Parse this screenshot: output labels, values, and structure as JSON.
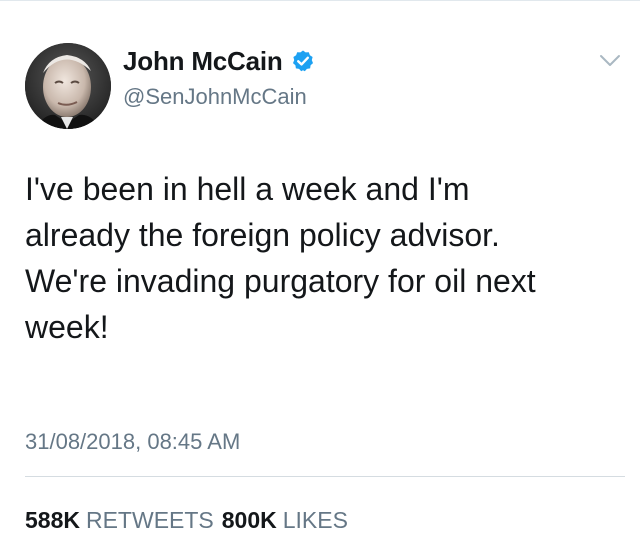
{
  "author": {
    "display_name": "John McCain",
    "handle": "@SenJohnMcCain",
    "verified": true,
    "verified_icon": "verified-badge-icon",
    "avatar": "profile-photo"
  },
  "tweet": {
    "text_lines": [
      "I've been in hell a week and I'm",
      "already the foreign policy advisor.",
      "We're invading purgatory for oil next",
      "week!"
    ],
    "timestamp": "31/08/2018, 08:45 AM"
  },
  "stats": {
    "retweets_count": "588K",
    "retweets_label": "RETWEETS",
    "likes_count": "800K",
    "likes_label": "LIKES"
  },
  "icons": {
    "menu": "chevron-down-icon"
  },
  "colors": {
    "text_primary": "#14171a",
    "text_secondary": "#657786",
    "verified_blue": "#1da1f2",
    "divider": "#d5dce1"
  }
}
